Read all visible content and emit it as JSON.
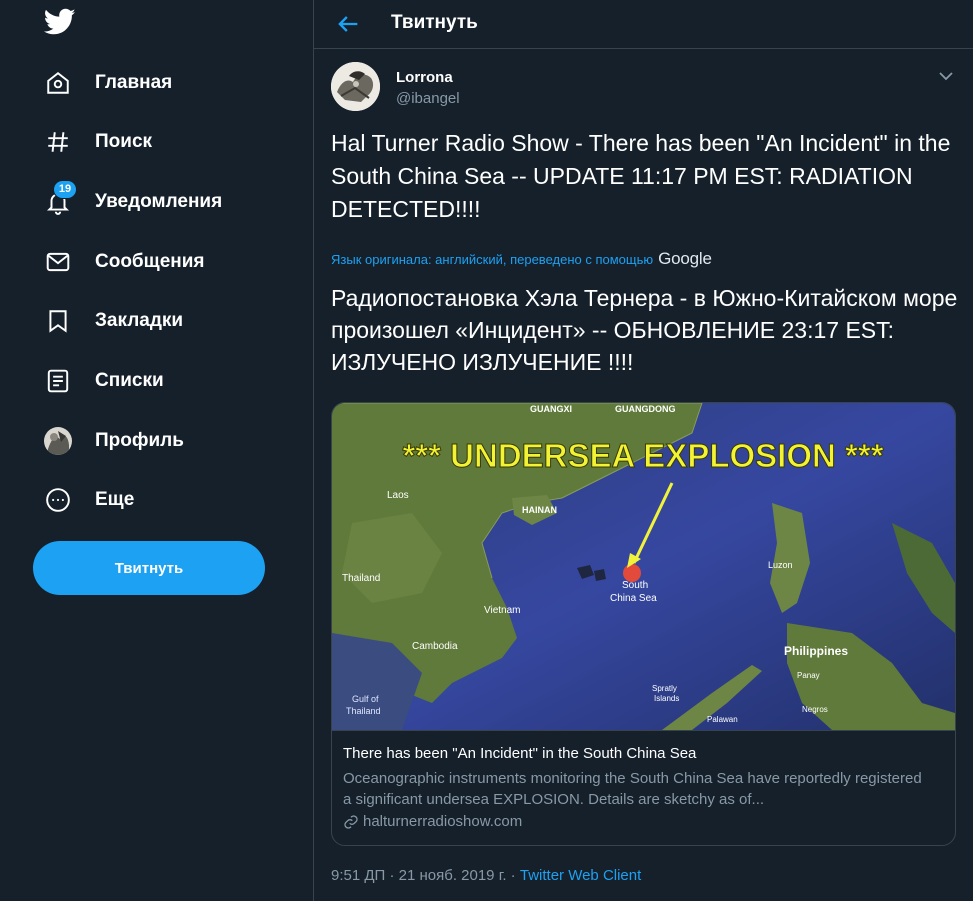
{
  "sidebar": {
    "logo": "twitter-bird-icon",
    "items": [
      {
        "label": "Главная",
        "icon": "home-icon"
      },
      {
        "label": "Поиск",
        "icon": "hashtag-icon"
      },
      {
        "label": "Уведомления",
        "icon": "bell-icon",
        "badge": "19"
      },
      {
        "label": "Сообщения",
        "icon": "envelope-icon"
      },
      {
        "label": "Закладки",
        "icon": "bookmark-icon"
      },
      {
        "label": "Списки",
        "icon": "list-icon"
      },
      {
        "label": "Профиль",
        "icon": "avatar"
      },
      {
        "label": "Еще",
        "icon": "more-circle-icon"
      }
    ],
    "tweet_button": "Твитнуть"
  },
  "header": {
    "title": "Твитнуть"
  },
  "tweet": {
    "author_name": "Lorrona",
    "author_handle": "@ibangel",
    "text": "Hal Turner Radio Show - There has been \"An Incident\" in the South China Sea -- UPDATE 11:17 PM EST: RADIATION DETECTED!!!!",
    "translation_note": "Язык оригинала: английский, переведено с помощью",
    "translation_provider": "Google",
    "translated_text": "Радиопостановка Хэла Тернера - в Южно-Китайском море произошел «Инцидент» -- ОБНОВЛЕНИЕ 23:17 EST: ИЗЛУЧЕНО ИЗЛУЧЕНИЕ !!!!",
    "card": {
      "image_banner": "*** UNDERSEA EXPLOSION ***",
      "map_labels": {
        "guangxi": "GUANGXI",
        "guangdong": "GUANGDONG",
        "laos": "Laos",
        "hainan": "HAINAN",
        "thailand": "Thailand",
        "vietnam": "Vietnam",
        "cambodia": "Cambodia",
        "gulf": "Gulf of",
        "gulf2": "Thailand",
        "scs1": "South",
        "scs2": "China Sea",
        "luzon": "Luzon",
        "philippines": "Philippines",
        "panay": "Panay",
        "negros": "Negros",
        "spratly1": "Spratly",
        "spratly2": "Islands",
        "palawan": "Palawan"
      },
      "title": "There has been \"An Incident\" in the South China Sea",
      "description": "Oceanographic instruments monitoring the South China Sea have reportedly registered a significant undersea EXPLOSION.  Details are sketchy as of...",
      "domain": "halturnerradioshow.com"
    },
    "timestamp": "9:51 ДП · 21 нояб. 2019 г.",
    "separator": " · ",
    "client": "Twitter Web Client"
  },
  "colors": {
    "background": "#15202b",
    "accent": "#1da1f2",
    "border": "#38444d",
    "muted": "#8899a6"
  }
}
